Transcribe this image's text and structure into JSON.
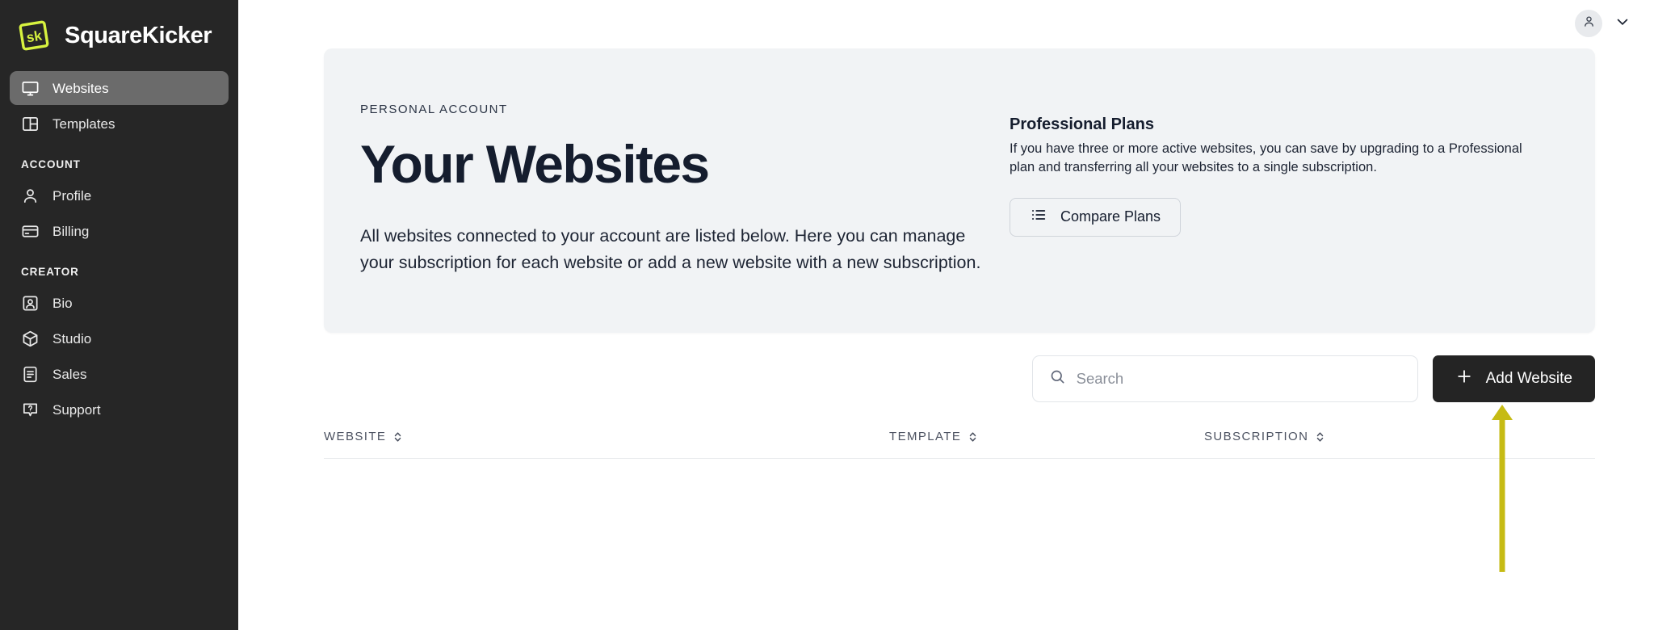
{
  "brand": {
    "name": "SquareKicker",
    "logo_text": "sk",
    "logo_color": "#d7f23f",
    "sidebar_bg": "#262626"
  },
  "sidebar": {
    "primary_items": [
      {
        "label": "Websites",
        "icon": "monitor-icon",
        "active": true
      },
      {
        "label": "Templates",
        "icon": "layout-icon",
        "active": false
      }
    ],
    "groups": [
      {
        "title": "ACCOUNT",
        "items": [
          {
            "label": "Profile",
            "icon": "user-icon"
          },
          {
            "label": "Billing",
            "icon": "credit-card-icon"
          }
        ]
      },
      {
        "title": "CREATOR",
        "items": [
          {
            "label": "Bio",
            "icon": "id-card-icon"
          },
          {
            "label": "Studio",
            "icon": "cube-icon"
          },
          {
            "label": "Sales",
            "icon": "document-icon"
          },
          {
            "label": "Support",
            "icon": "question-bubble-icon"
          }
        ]
      }
    ]
  },
  "topbar": {
    "avatar_icon": "user-avatar-icon",
    "chevron_icon": "chevron-down-icon"
  },
  "hero": {
    "eyebrow": "PERSONAL ACCOUNT",
    "title": "Your Websites",
    "description": "All websites connected to your account are listed below. Here you can manage your subscription for each website or add a new website with a new subscription.",
    "card_bg": "#f1f3f5"
  },
  "plans": {
    "title": "Professional Plans",
    "description": "If you have three or more active websites, you can save by upgrading to a Professional plan and transferring all your websites to a single subscription.",
    "compare_label": "Compare Plans",
    "compare_icon": "list-icon"
  },
  "toolbar": {
    "search_placeholder": "Search",
    "search_value": "",
    "search_icon": "search-icon",
    "add_label": "Add Website",
    "add_icon": "plus-icon",
    "add_bg": "#242424"
  },
  "table": {
    "columns": [
      {
        "label": "WEBSITE",
        "sortable": true
      },
      {
        "label": "TEMPLATE",
        "sortable": true
      },
      {
        "label": "SUBSCRIPTION",
        "sortable": true
      }
    ],
    "rows": []
  },
  "annotation": {
    "arrow_color": "#c6bb14",
    "points_at": "Add Website"
  }
}
